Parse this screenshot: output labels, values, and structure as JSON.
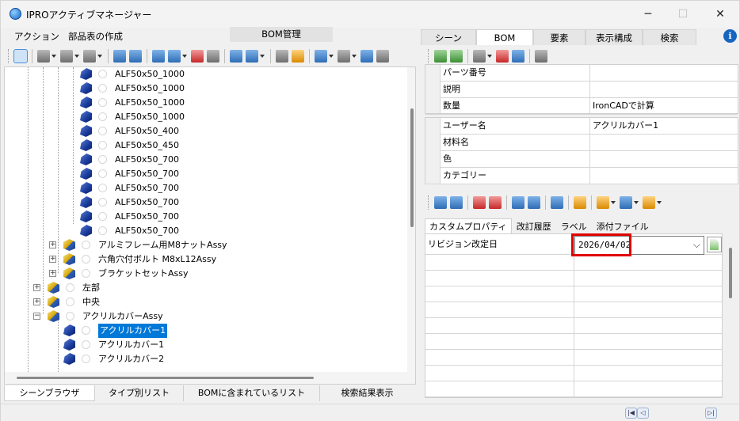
{
  "window": {
    "title": "IPROアクティブマネージャー",
    "minimize": "─",
    "maximize": "☐",
    "close": "✕"
  },
  "menu": {
    "action": "アクション",
    "bom_create": "部品表の作成",
    "bom_manage": "BOM管理"
  },
  "tree": {
    "parts": [
      "ALF50x50_1000",
      "ALF50x50_1000",
      "ALF50x50_1000",
      "ALF50x50_1000",
      "ALF50x50_400",
      "ALF50x50_450",
      "ALF50x50_700",
      "ALF50x50_700",
      "ALF50x50_700",
      "ALF50x50_700",
      "ALF50x50_700",
      "ALF50x50_700"
    ],
    "assemblies": [
      "アルミフレーム用M8ナットAssy",
      "六角穴付ボルト M8xL12Assy",
      "ブラケットセットAssy"
    ],
    "groups": [
      "左部",
      "中央",
      "アクリルカバーAssy"
    ],
    "acrylic": [
      "アクリルカバー1",
      "アクリルカバー1",
      "アクリルカバー2"
    ]
  },
  "bottom_tabs": [
    "シーンブラウザ",
    "タイプ別リスト",
    "BOMに含まれているリスト",
    "検索結果表示"
  ],
  "right_tabs": [
    "シーン",
    "BOM",
    "要素",
    "表示構成",
    "検索"
  ],
  "bom_grid_top": [
    {
      "key": "パーツ番号",
      "value": ""
    },
    {
      "key": "説明",
      "value": ""
    },
    {
      "key": "数量",
      "value": "IronCADで計算"
    }
  ],
  "bom_grid_bottom": [
    {
      "key": "ユーザー名",
      "value": "アクリルカバー1"
    },
    {
      "key": "材料名",
      "value": ""
    },
    {
      "key": "色",
      "value": ""
    },
    {
      "key": "カテゴリー",
      "value": ""
    }
  ],
  "prop_tabs": [
    "カスタムプロパティ",
    "改訂履歴",
    "ラベル",
    "添付ファイル"
  ],
  "custom": {
    "revision_date_label": "リビジョン改定日",
    "revision_date_value": "2026/04/02"
  },
  "colors": {
    "highlight": "#0078d7",
    "redbox": "#e00000"
  }
}
